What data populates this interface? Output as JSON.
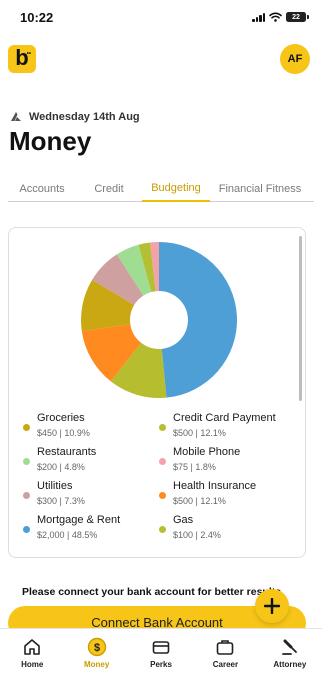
{
  "status_bar": {
    "time": "10:22",
    "battery": "22"
  },
  "header": {
    "logo_letter": "b",
    "avatar_initials": "AF",
    "date": "Wednesday 14th Aug",
    "title": "Money"
  },
  "tabs": [
    {
      "label": "Accounts",
      "active": false
    },
    {
      "label": "Credit",
      "active": false
    },
    {
      "label": "Budgeting",
      "active": true
    },
    {
      "label": "Financial Fitness",
      "active": false
    }
  ],
  "chart_data": {
    "type": "pie",
    "donut": true,
    "slices": [
      {
        "label": "Mortgage & Rent",
        "value": 2000,
        "percent": 48.5,
        "color": "#4d9fd6"
      },
      {
        "label": "Credit Card Payment",
        "value": 500,
        "percent": 12.1,
        "color": "#b6bd2e"
      },
      {
        "label": "Health Insurance",
        "value": 500,
        "percent": 12.1,
        "color": "#ff8a1f"
      },
      {
        "label": "Groceries",
        "value": 450,
        "percent": 10.9,
        "color": "#c9a814"
      },
      {
        "label": "Utilities",
        "value": 300,
        "percent": 7.3,
        "color": "#cfa0a0"
      },
      {
        "label": "Restaurants",
        "value": 200,
        "percent": 4.8,
        "color": "#9fdd93"
      },
      {
        "label": "Gas",
        "value": 100,
        "percent": 2.4,
        "color": "#b3c034"
      },
      {
        "label": "Mobile Phone",
        "value": 75,
        "percent": 1.8,
        "color": "#f4a1a8"
      }
    ]
  },
  "legend": [
    {
      "name": "Groceries",
      "detail": "$450 | 10.9%",
      "color": "#c9a814"
    },
    {
      "name": "Credit Card Payment",
      "detail": "$500 | 12.1%",
      "color": "#b6bd2e"
    },
    {
      "name": "Restaurants",
      "detail": "$200 | 4.8%",
      "color": "#9fdd93"
    },
    {
      "name": "Mobile Phone",
      "detail": "$75 | 1.8%",
      "color": "#f4a1a8"
    },
    {
      "name": "Utilities",
      "detail": "$300 | 7.3%",
      "color": "#cfa0a0"
    },
    {
      "name": "Health Insurance",
      "detail": "$500 | 12.1%",
      "color": "#ff8a1f"
    },
    {
      "name": "Mortgage & Rent",
      "detail": "$2,000 | 48.5%",
      "color": "#4d9fd6"
    },
    {
      "name": "Gas",
      "detail": "$100 | 2.4%",
      "color": "#b3c034"
    }
  ],
  "connect": {
    "message": "Please connect your bank account for better results",
    "button_label": "Connect Bank Account"
  },
  "bottom_nav": [
    {
      "label": "Home",
      "icon": "home-icon",
      "active": false
    },
    {
      "label": "Money",
      "icon": "money-icon",
      "active": true
    },
    {
      "label": "Perks",
      "icon": "perks-icon",
      "active": false
    },
    {
      "label": "Career",
      "icon": "career-icon",
      "active": false
    },
    {
      "label": "Attorney",
      "icon": "attorney-icon",
      "active": false
    }
  ],
  "colors": {
    "brand_yellow": "#f6c518",
    "active_tab": "#c79d00"
  }
}
